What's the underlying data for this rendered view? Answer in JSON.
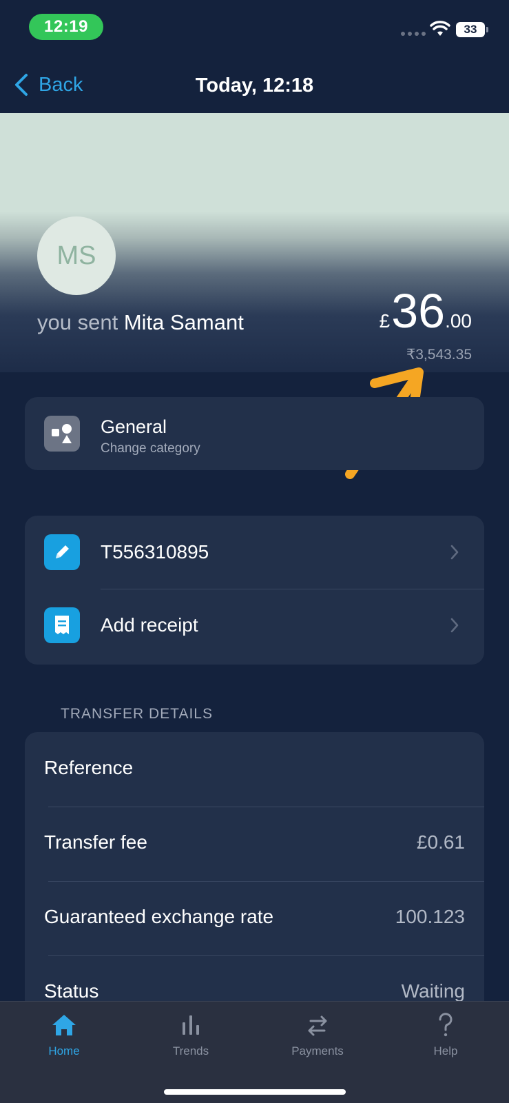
{
  "status_bar": {
    "time": "12:19",
    "battery": "33"
  },
  "nav": {
    "back_label": "Back",
    "title": "Today, 12:18"
  },
  "header": {
    "avatar_initials": "MS",
    "sent_prefix": "you sent",
    "recipient": "Mita Samant",
    "amount_currency": "£",
    "amount_whole": "36",
    "amount_decimal": ".00",
    "converted_amount": "₹3,543.35"
  },
  "category": {
    "title": "General",
    "subtitle": "Change category"
  },
  "actions": [
    {
      "label": "T556310895",
      "icon": "pencil-icon"
    },
    {
      "label": "Add receipt",
      "icon": "receipt-icon"
    }
  ],
  "transfer_details": {
    "section_title": "TRANSFER DETAILS",
    "rows": [
      {
        "label": "Reference",
        "value": ""
      },
      {
        "label": "Transfer fee",
        "value": "£0.61"
      },
      {
        "label": "Guaranteed exchange rate",
        "value": "100.123"
      },
      {
        "label": "Status",
        "value": "Waiting"
      }
    ]
  },
  "tab_bar": {
    "active": "Home",
    "tabs": [
      {
        "label": "Home",
        "icon": "home-icon"
      },
      {
        "label": "Trends",
        "icon": "bar-chart-icon"
      },
      {
        "label": "Payments",
        "icon": "transfer-arrows-icon"
      },
      {
        "label": "Help",
        "icon": "question-mark-icon"
      }
    ]
  },
  "colors": {
    "background": "#14223d",
    "card": "#22304a",
    "accent_blue": "#2fa6e6",
    "annotation_arrow": "#f5a623",
    "status_green": "#33c659"
  }
}
